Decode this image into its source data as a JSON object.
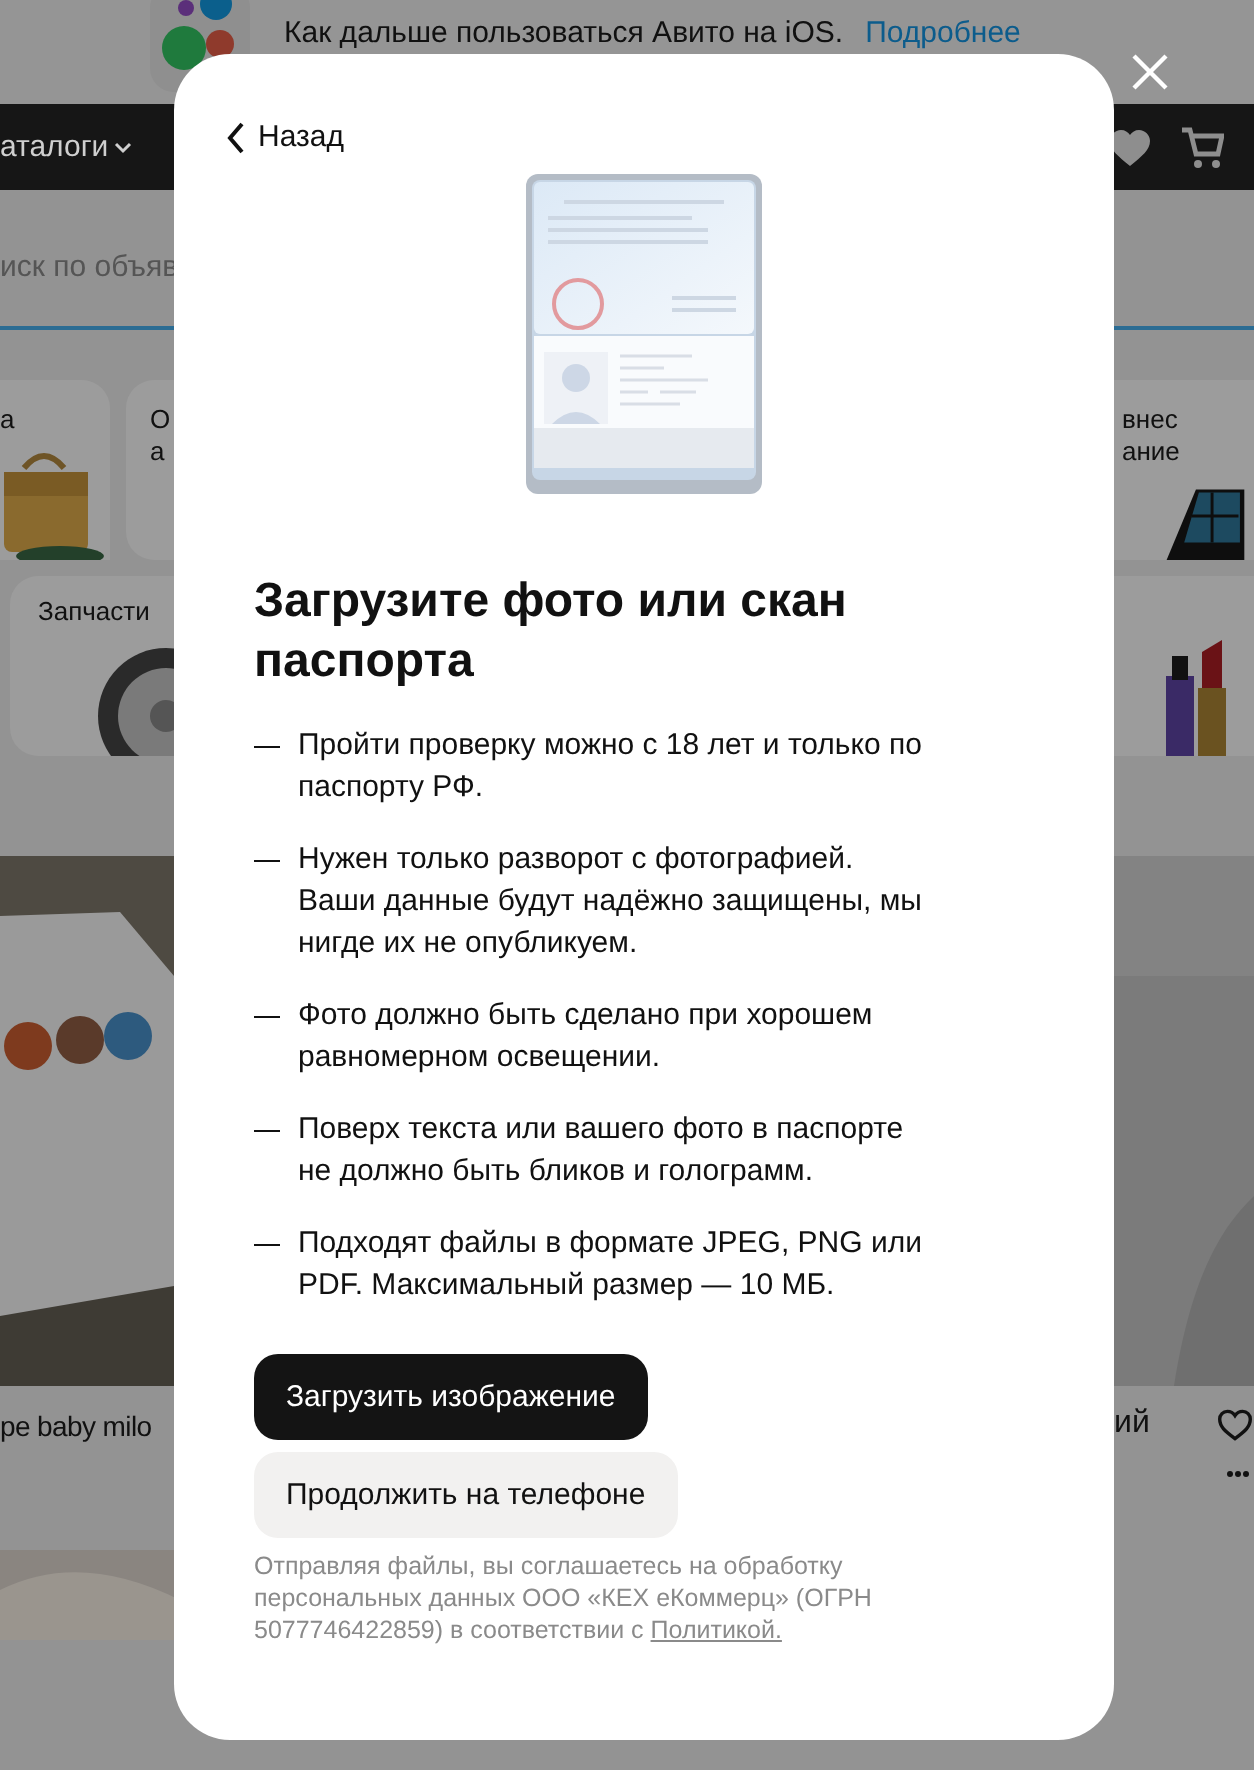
{
  "banner": {
    "text": "Как дальше пользоваться Авито на iOS.",
    "link": "Подробнее"
  },
  "nav": {
    "catalog": "аталоги"
  },
  "search": {
    "placeholder": "иск по объяв"
  },
  "categories": [
    {
      "lines": [
        "а"
      ]
    },
    {
      "lines": [
        "О",
        "а"
      ]
    },
    {
      "lines": [
        "внес",
        "ание"
      ]
    },
    {
      "lines": [
        "Запчасти"
      ]
    }
  ],
  "products": [
    {
      "title": "pe baby milo"
    },
    {
      "title": "ий"
    }
  ],
  "modal": {
    "back": "Назад",
    "title": "Загрузите фото или скан паспорта",
    "requirements": [
      "Пройти проверку можно с 18 лет и только по паспорту РФ.",
      "Нужен только разворот с фотографией. Ваши данные будут надёжно защищены, мы нигде их не опубликуем.",
      "Фото должно быть сделано при хорошем равномерном освещении.",
      "Поверх текста или вашего фото в паспорте не должно быть бликов и голограмм.",
      "Подходят файлы в формате JPEG, PNG или PDF. Максимальный размер — 10 МБ."
    ],
    "primary_button": "Загрузить изображение",
    "secondary_button": "Продолжить на телефоне",
    "consent": "Отправляя файлы, вы соглашаетесь на обработку персональных данных ООО «КЕХ еКоммерц» (ОГРН 5077746422859) в соответствии с",
    "consent_link": "Политикой."
  }
}
